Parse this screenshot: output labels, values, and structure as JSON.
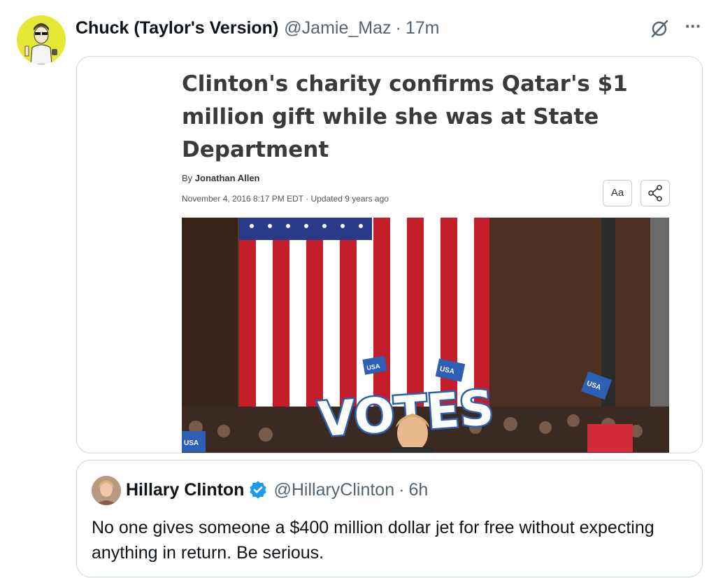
{
  "tweet": {
    "display_name": "Chuck (Taylor's Version)",
    "handle": "@Jamie_Maz",
    "separator": "·",
    "time": "17m",
    "more_label": "···"
  },
  "article": {
    "headline": "Clinton's charity confirms Qatar's $1 million gift while she was at State Department",
    "byline_prefix": "By",
    "author": "Jonathan Allen",
    "dateline": "November 4, 2016 8:17 PM EDT · Updated 9 years ago",
    "text_size_label": "Aa",
    "photo_sign_text": "VOTES",
    "photo_small_signs": [
      "USA",
      "USA",
      "USA",
      "USA"
    ]
  },
  "quoted": {
    "display_name": "Hillary Clinton",
    "handle": "@HillaryClinton",
    "separator": "·",
    "time": "6h",
    "text": "No one gives someone a $400 million dollar jet for free without expecting anything in return. Be serious."
  },
  "colors": {
    "verified": "#1d9bf0",
    "secondary_text": "#536471",
    "border": "#cfd9de"
  }
}
